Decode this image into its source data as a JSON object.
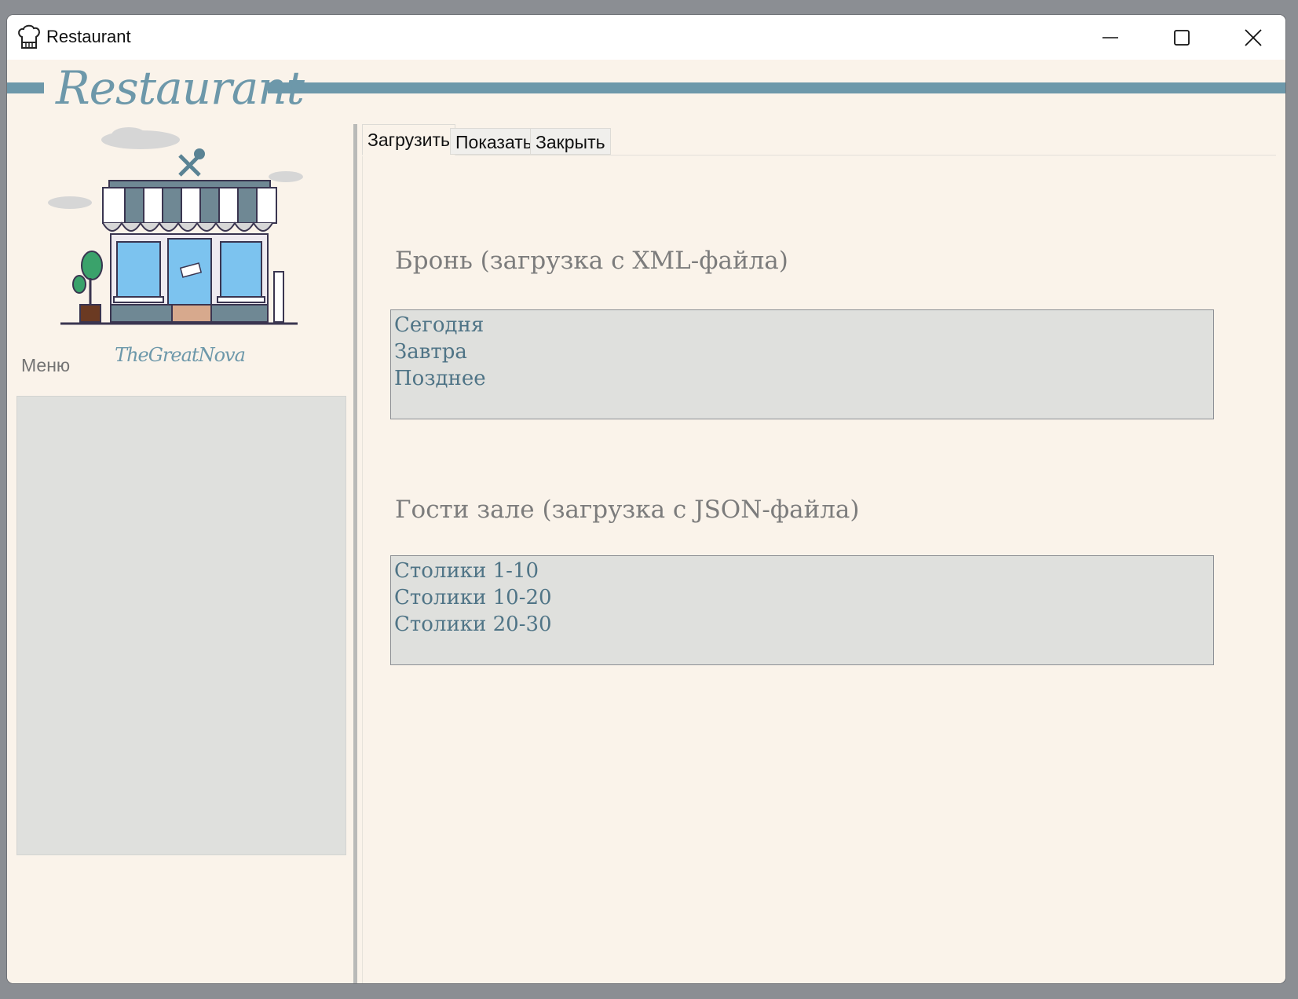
{
  "window": {
    "title": "Restaurant"
  },
  "header": {
    "brand": "Restaurant",
    "sign": "TheGreatNova"
  },
  "sidebar": {
    "menu_label": "Меню"
  },
  "tabs": [
    {
      "label": "Загрузить",
      "active": true
    },
    {
      "label": "Показать",
      "active": false
    },
    {
      "label": "Закрыть",
      "active": false
    }
  ],
  "booking": {
    "title": "Бронь (загрузка с XML-файла)",
    "items": [
      "Сегодня",
      "Завтра",
      "Позднее"
    ]
  },
  "guests": {
    "title": "Гости зале (загрузка с JSON-файла)",
    "items": [
      "Столики 1-10",
      "Столики 10-20",
      "Столики 20-30"
    ]
  },
  "colors": {
    "accent": "#6d98aa",
    "background": "#faf3ea",
    "list_bg": "#dfe0dd",
    "list_text": "#4f7486"
  }
}
